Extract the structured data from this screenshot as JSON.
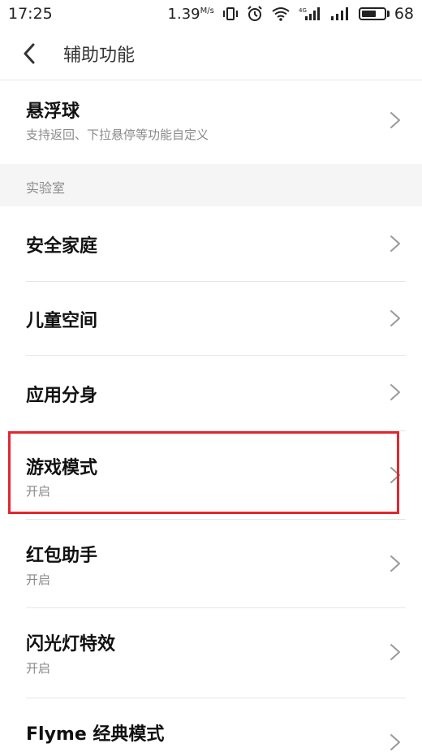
{
  "status_bar": {
    "time": "17:25",
    "net_speed": "1.39",
    "net_unit": "M/s",
    "battery": "68",
    "battery_level": 0.68
  },
  "header": {
    "title": "辅助功能"
  },
  "floating_ball": {
    "title": "悬浮球",
    "subtitle": "支持返回、下拉悬停等功能自定义"
  },
  "section": {
    "label": "实验室"
  },
  "items": [
    {
      "title": "安全家庭"
    },
    {
      "title": "儿童空间"
    },
    {
      "title": "应用分身"
    },
    {
      "title": "游戏模式",
      "status": "开启"
    },
    {
      "title": "红包助手",
      "status": "开启"
    },
    {
      "title": "闪光灯特效",
      "status": "开启"
    },
    {
      "title": "Flyme 经典模式"
    }
  ],
  "colors": {
    "highlight": "#e5262e",
    "section_bg": "#f5f5f5"
  }
}
